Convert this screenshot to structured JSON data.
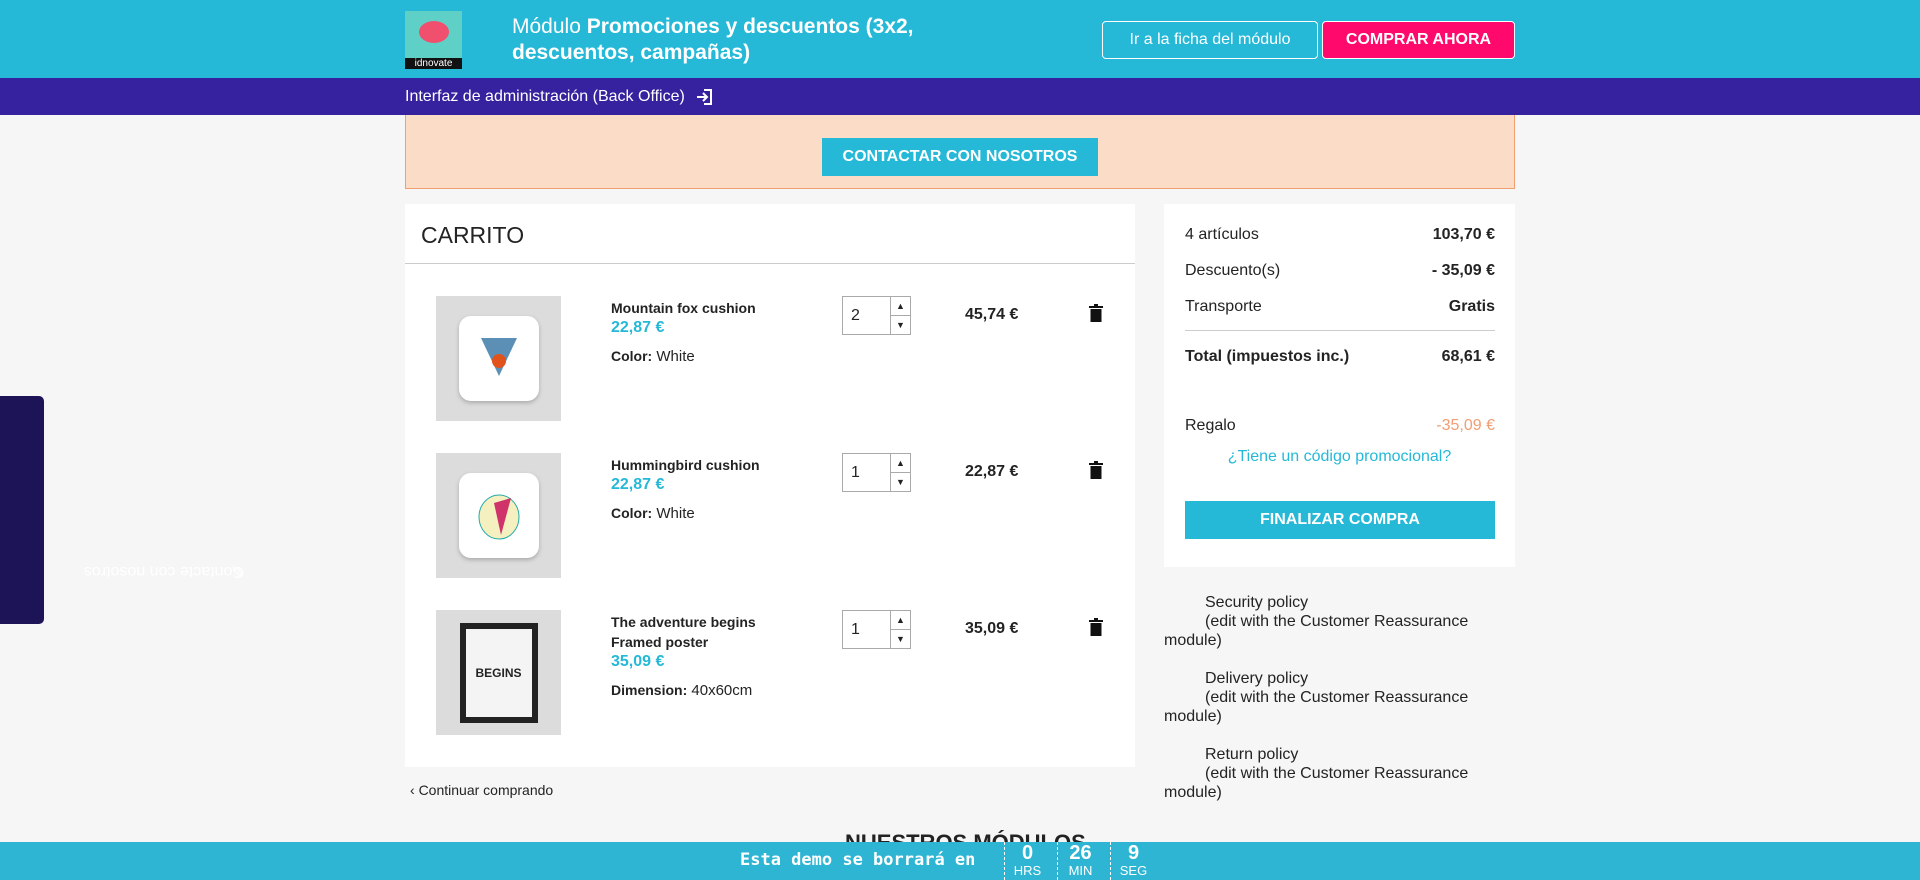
{
  "header": {
    "logo_text": "idnovate",
    "title_prefix": "Módulo",
    "title_bold": "Promociones y descuentos (3x2, descuentos, campañas)",
    "ficha_button": "Ir a la ficha del módulo",
    "buy_button": "COMPRAR AHORA"
  },
  "backoffice": {
    "label": "Interfaz de administración (Back Office)"
  },
  "notice": {
    "contact_button": "CONTACTAR CON NOSOTROS"
  },
  "cart": {
    "title": "CARRITO",
    "items": [
      {
        "name": "Mountain fox cushion",
        "unit_price": "22,87 €",
        "attr_label": "Color:",
        "attr_value": "White",
        "qty": "2",
        "total": "45,74 €"
      },
      {
        "name": "Hummingbird cushion",
        "unit_price": "22,87 €",
        "attr_label": "Color:",
        "attr_value": "White",
        "qty": "1",
        "total": "22,87 €"
      },
      {
        "name": "The adventure begins Framed poster",
        "unit_price": "35,09 €",
        "attr_label": "Dimension:",
        "attr_value": "40x60cm",
        "qty": "1",
        "total": "35,09 €",
        "image_text": "BEGINS"
      }
    ],
    "continue": "Continuar comprando"
  },
  "summary": {
    "items_label": "4 artículos",
    "items_value": "103,70 €",
    "discount_label": "Descuento(s)",
    "discount_value": "- 35,09 €",
    "shipping_label": "Transporte",
    "shipping_value": "Gratis",
    "total_label": "Total (impuestos inc.)",
    "total_value": "68,61 €",
    "gift_label": "Regalo",
    "gift_value": "-35,09 €",
    "promo_link": "¿Tiene un código promocional?",
    "checkout": "FINALIZAR COMPRA"
  },
  "reassurance": [
    {
      "title": "Security policy",
      "sub": "(edit with the Customer Reassurance",
      "end": "module)"
    },
    {
      "title": "Delivery policy",
      "sub": "(edit with the Customer Reassurance",
      "end": "module)"
    },
    {
      "title": "Return policy",
      "sub": "(edit with the Customer Reassurance",
      "end": "module)"
    }
  ],
  "side_tab": "Contacte con nosotros",
  "footer_heading": "NUESTROS MÓDULOS",
  "demo": {
    "message": "Esta demo se borrará en",
    "hrs": "0",
    "hrs_label": "HRS",
    "min": "26",
    "min_label": "MIN",
    "sec": "9",
    "sec_label": "SEG"
  },
  "colors": {
    "primary": "#25b9d7",
    "purple": "#36219e",
    "pink": "#ff0a6c",
    "gift": "#f39d72"
  }
}
